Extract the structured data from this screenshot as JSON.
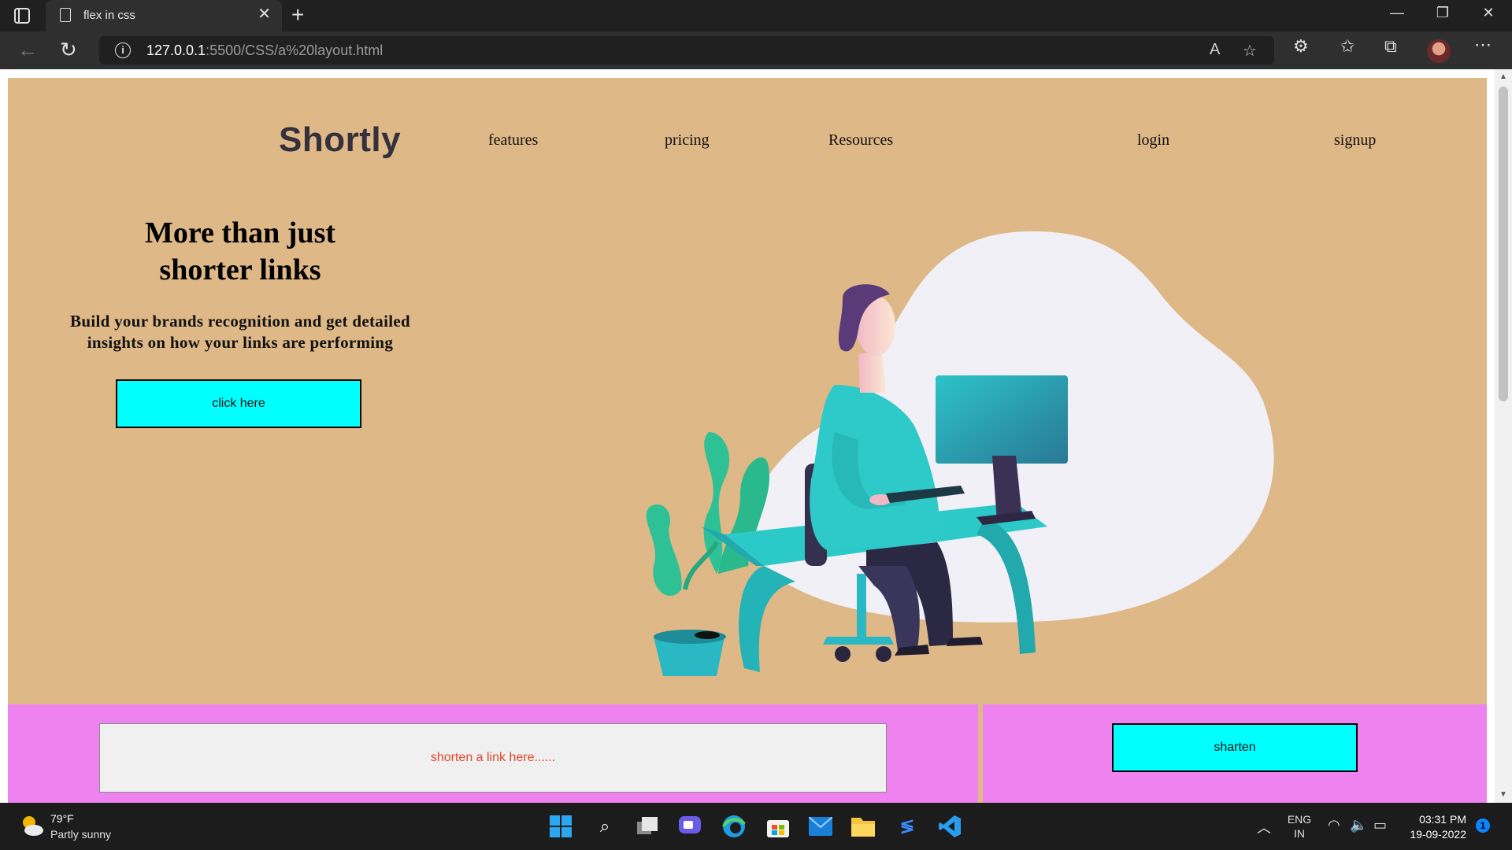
{
  "browser": {
    "tab_title": "flex in css",
    "url_host": "127.0.0.1",
    "url_path": ":5500/CSS/a%20layout.html",
    "icons": [
      "tab-actions-icon",
      "document-icon",
      "close-icon",
      "plus-icon",
      "minimize-icon",
      "restore-icon",
      "window-close-icon",
      "back-icon",
      "reload-icon",
      "info-icon",
      "read-aloud-icon",
      "add-favorite-icon",
      "extensions-icon",
      "favorites-icon",
      "collections-icon",
      "profile-avatar",
      "more-icon"
    ]
  },
  "page": {
    "logo": "Shortly",
    "nav": {
      "features": "features",
      "pricing": "pricing",
      "resources": "Resources",
      "login": "login",
      "signup": "signup"
    },
    "headline_line1": "More than just",
    "headline_line2": "shorter links",
    "subtext_line1": "Build your brands recognition and get detailed",
    "subtext_line2": "insights on how your links are performing",
    "cta_label": "click here",
    "shorten": {
      "placeholder": "shorten a link here......",
      "button_label": "sharten"
    },
    "colors": {
      "hero_bg": "#deb887",
      "shorten_bg": "#ee82ee",
      "button_bg": "#00ffff"
    }
  },
  "taskbar": {
    "weather_temp": "79°F",
    "weather_desc": "Partly sunny",
    "lang_line1": "ENG",
    "lang_line2": "IN",
    "time": "03:31 PM",
    "date": "19-09-2022",
    "notification_count": "1",
    "apps": [
      "start-icon",
      "search-icon",
      "task-view-icon",
      "chat-icon",
      "edge-icon",
      "store-icon",
      "mail-icon",
      "file-explorer-icon",
      "power-automate-icon",
      "vscode-icon"
    ]
  }
}
